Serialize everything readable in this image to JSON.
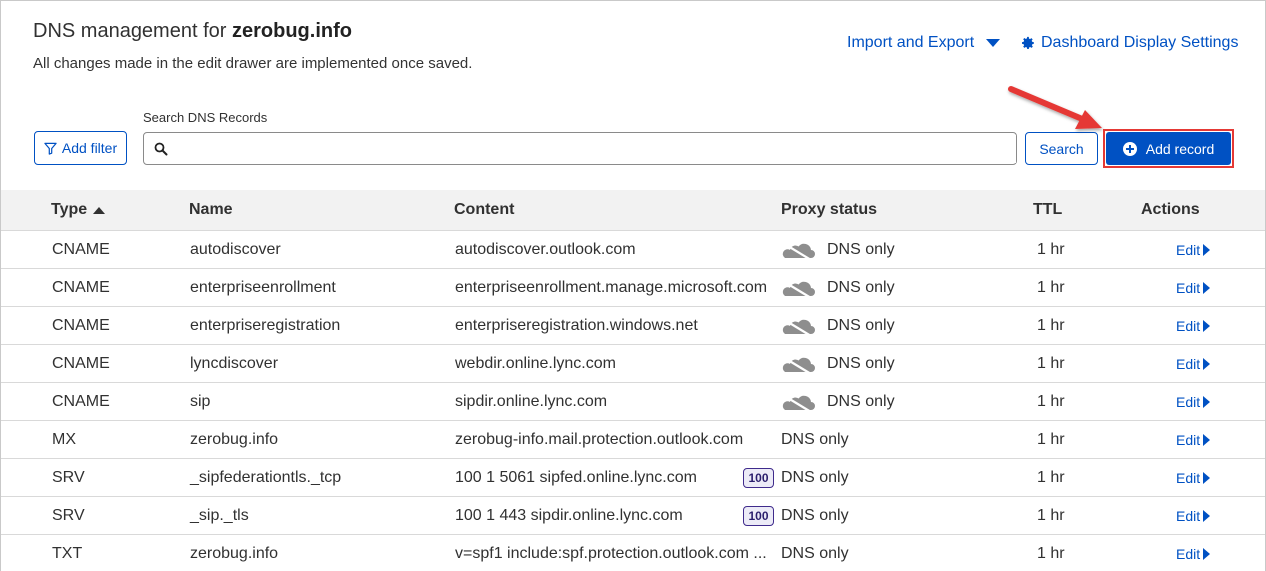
{
  "header": {
    "title_prefix": "DNS management for",
    "domain": "zerobug.info",
    "subtitle": "All changes made in the edit drawer are implemented once saved.",
    "import_export": "Import and Export",
    "dashboard_settings": "Dashboard Display Settings"
  },
  "toolbar": {
    "add_filter": "Add filter",
    "search_label": "Search DNS Records",
    "search_placeholder": "",
    "search_button": "Search",
    "add_record": "Add record"
  },
  "colors": {
    "accent": "#0051c3",
    "highlight": "#e53935"
  },
  "table": {
    "headers": {
      "type": "Type",
      "name": "Name",
      "content": "Content",
      "proxy": "Proxy status",
      "ttl": "TTL",
      "actions": "Actions"
    },
    "edit_label": "Edit",
    "rows": [
      {
        "type": "CNAME",
        "name": "autodiscover",
        "content": "autodiscover.outlook.com",
        "proxy": "DNS only",
        "cloud": true,
        "priority": "",
        "ttl": "1 hr"
      },
      {
        "type": "CNAME",
        "name": "enterpriseenrollment",
        "content": "enterpriseenrollment.manage.microsoft.com",
        "proxy": "DNS only",
        "cloud": true,
        "priority": "",
        "ttl": "1 hr"
      },
      {
        "type": "CNAME",
        "name": "enterpriseregistration",
        "content": "enterpriseregistration.windows.net",
        "proxy": "DNS only",
        "cloud": true,
        "priority": "",
        "ttl": "1 hr"
      },
      {
        "type": "CNAME",
        "name": "lyncdiscover",
        "content": "webdir.online.lync.com",
        "proxy": "DNS only",
        "cloud": true,
        "priority": "",
        "ttl": "1 hr"
      },
      {
        "type": "CNAME",
        "name": "sip",
        "content": "sipdir.online.lync.com",
        "proxy": "DNS only",
        "cloud": true,
        "priority": "",
        "ttl": "1 hr"
      },
      {
        "type": "MX",
        "name": "zerobug.info",
        "content": "zerobug-info.mail.protection.outlook.com",
        "proxy": "DNS only",
        "cloud": false,
        "priority": "",
        "ttl": "1 hr"
      },
      {
        "type": "SRV",
        "name": "_sipfederationtls._tcp",
        "content": "100 1 5061 sipfed.online.lync.com",
        "proxy": "DNS only",
        "cloud": false,
        "priority": "100",
        "ttl": "1 hr"
      },
      {
        "type": "SRV",
        "name": "_sip._tls",
        "content": "100 1 443 sipdir.online.lync.com",
        "proxy": "DNS only",
        "cloud": false,
        "priority": "100",
        "ttl": "1 hr"
      },
      {
        "type": "TXT",
        "name": "zerobug.info",
        "content": "v=spf1 include:spf.protection.outlook.com ...",
        "proxy": "DNS only",
        "cloud": false,
        "priority": "",
        "ttl": "1 hr"
      }
    ]
  }
}
